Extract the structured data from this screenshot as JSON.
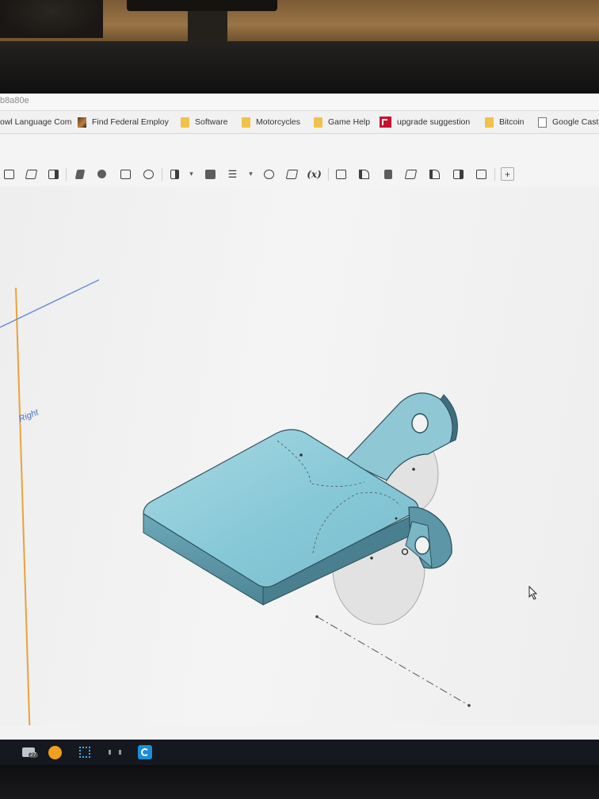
{
  "browser": {
    "url_fragment": "b8a80e",
    "bookmarks": [
      {
        "label": "owl Language Com",
        "icon": "page-icon"
      },
      {
        "label": "Find Federal Employ",
        "icon": "federal-icon"
      },
      {
        "label": "Software",
        "icon": "folder-icon"
      },
      {
        "label": "Motorcycles",
        "icon": "folder-icon"
      },
      {
        "label": "Game Help",
        "icon": "folder-icon"
      },
      {
        "label": "upgrade suggestion",
        "icon": "upgrade-icon"
      },
      {
        "label": "Bitcoin",
        "icon": "folder-icon"
      },
      {
        "label": "Google Cast",
        "icon": "page-icon"
      }
    ]
  },
  "cad": {
    "toolbar": {
      "variable_label": "(x)",
      "icons": [
        "sketch-icon",
        "extrude-icon",
        "revolve-icon",
        "sweep-icon",
        "loft-icon",
        "boolean-icon",
        "fillet-icon",
        "shell-icon",
        "draft-icon",
        "plane-icon",
        "pattern-icon",
        "history-icon",
        "transform-icon",
        "variable-icon",
        "sheet-metal-icon",
        "flange-icon",
        "tab-icon",
        "unfold-icon",
        "bend-icon",
        "corner-icon",
        "finish-icon",
        "add-icon"
      ]
    },
    "plane_label": "Right"
  },
  "taskbar": {
    "badge_count": "27",
    "apps": [
      "mail-icon",
      "emoji-app-icon",
      "network-icon",
      "media-app-icon",
      "onshape-app-icon"
    ]
  },
  "colors": {
    "part_body": "#8cc9d6",
    "part_edge": "#2b4f5c",
    "plane_orange": "#e9a23b",
    "plane_blue": "#6b8fd6",
    "taskbar": "#15181f"
  }
}
